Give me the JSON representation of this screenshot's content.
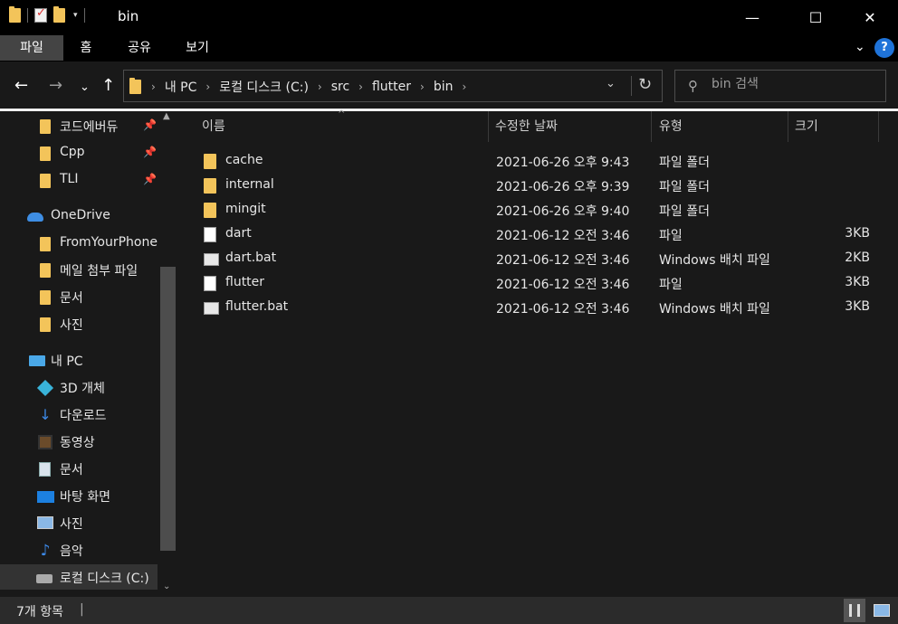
{
  "window": {
    "title": "bin",
    "minimize_glyph": "—",
    "maximize_glyph": "☐",
    "close_glyph": "✕",
    "qat_dropdown_glyph": "▾"
  },
  "ribbon": {
    "tabs": [
      {
        "label": "파일",
        "active": true
      },
      {
        "label": "홈"
      },
      {
        "label": "공유"
      },
      {
        "label": "보기"
      }
    ],
    "collapse_glyph": "⌄",
    "help_glyph": "?"
  },
  "nav": {
    "back_glyph": "←",
    "forward_glyph": "→",
    "recent_glyph": "⌄",
    "up_glyph": "↑"
  },
  "address": {
    "crumbs": [
      "내 PC",
      "로컬 디스크 (C:)",
      "src",
      "flutter",
      "bin"
    ],
    "separator_glyph": "›",
    "dropdown_glyph": "⌄",
    "refresh_glyph": "↻"
  },
  "search": {
    "placeholder": "bin 검색",
    "icon": "search-icon",
    "icon_glyph": "⚲"
  },
  "navpane": {
    "pin_glyph": "📌",
    "quick_access": [
      {
        "label": "코드에버듀",
        "pinned": true
      },
      {
        "label": "Cpp",
        "pinned": true
      },
      {
        "label": "TLI",
        "pinned": true
      }
    ],
    "onedrive": {
      "label": "OneDrive",
      "children": [
        "FromYourPhone",
        "메일 첨부 파일",
        "문서",
        "사진"
      ]
    },
    "this_pc": {
      "label": "내 PC",
      "children": [
        {
          "label": "3D 개체",
          "icon": "3d-objects-icon"
        },
        {
          "label": "다운로드",
          "icon": "downloads-icon"
        },
        {
          "label": "동영상",
          "icon": "videos-icon"
        },
        {
          "label": "문서",
          "icon": "documents-icon"
        },
        {
          "label": "바탕 화면",
          "icon": "desktop-icon"
        },
        {
          "label": "사진",
          "icon": "pictures-icon"
        },
        {
          "label": "음악",
          "icon": "music-icon"
        },
        {
          "label": "로컬 디스크 (C:)",
          "icon": "drive-icon",
          "selected": true
        }
      ]
    },
    "down_glyph": "↓",
    "music_glyph": "♪",
    "scroll_up_glyph": "▲",
    "scroll_down_glyph": "⌄"
  },
  "columns": {
    "name": "이름",
    "date": "수정한 날짜",
    "type": "유형",
    "size": "크기",
    "sort_glyph": "^"
  },
  "files": [
    {
      "name": "cache",
      "date": "2021-06-26 오후 9:43",
      "type": "파일 폴더",
      "size": "",
      "kind": "folder"
    },
    {
      "name": "internal",
      "date": "2021-06-26 오후 9:39",
      "type": "파일 폴더",
      "size": "",
      "kind": "folder"
    },
    {
      "name": "mingit",
      "date": "2021-06-26 오후 9:40",
      "type": "파일 폴더",
      "size": "",
      "kind": "folder"
    },
    {
      "name": "dart",
      "date": "2021-06-12 오전 3:46",
      "type": "파일",
      "size": "3KB",
      "kind": "file"
    },
    {
      "name": "dart.bat",
      "date": "2021-06-12 오전 3:46",
      "type": "Windows 배치 파일",
      "size": "2KB",
      "kind": "bat"
    },
    {
      "name": "flutter",
      "date": "2021-06-12 오전 3:46",
      "type": "파일",
      "size": "3KB",
      "kind": "file"
    },
    {
      "name": "flutter.bat",
      "date": "2021-06-12 오전 3:46",
      "type": "Windows 배치 파일",
      "size": "3KB",
      "kind": "bat"
    }
  ],
  "status": {
    "item_count": "7개 항목",
    "separator": "|"
  },
  "colors": {
    "background": "#191919",
    "folder": "#f3c45a",
    "accent": "#1f73d9"
  }
}
